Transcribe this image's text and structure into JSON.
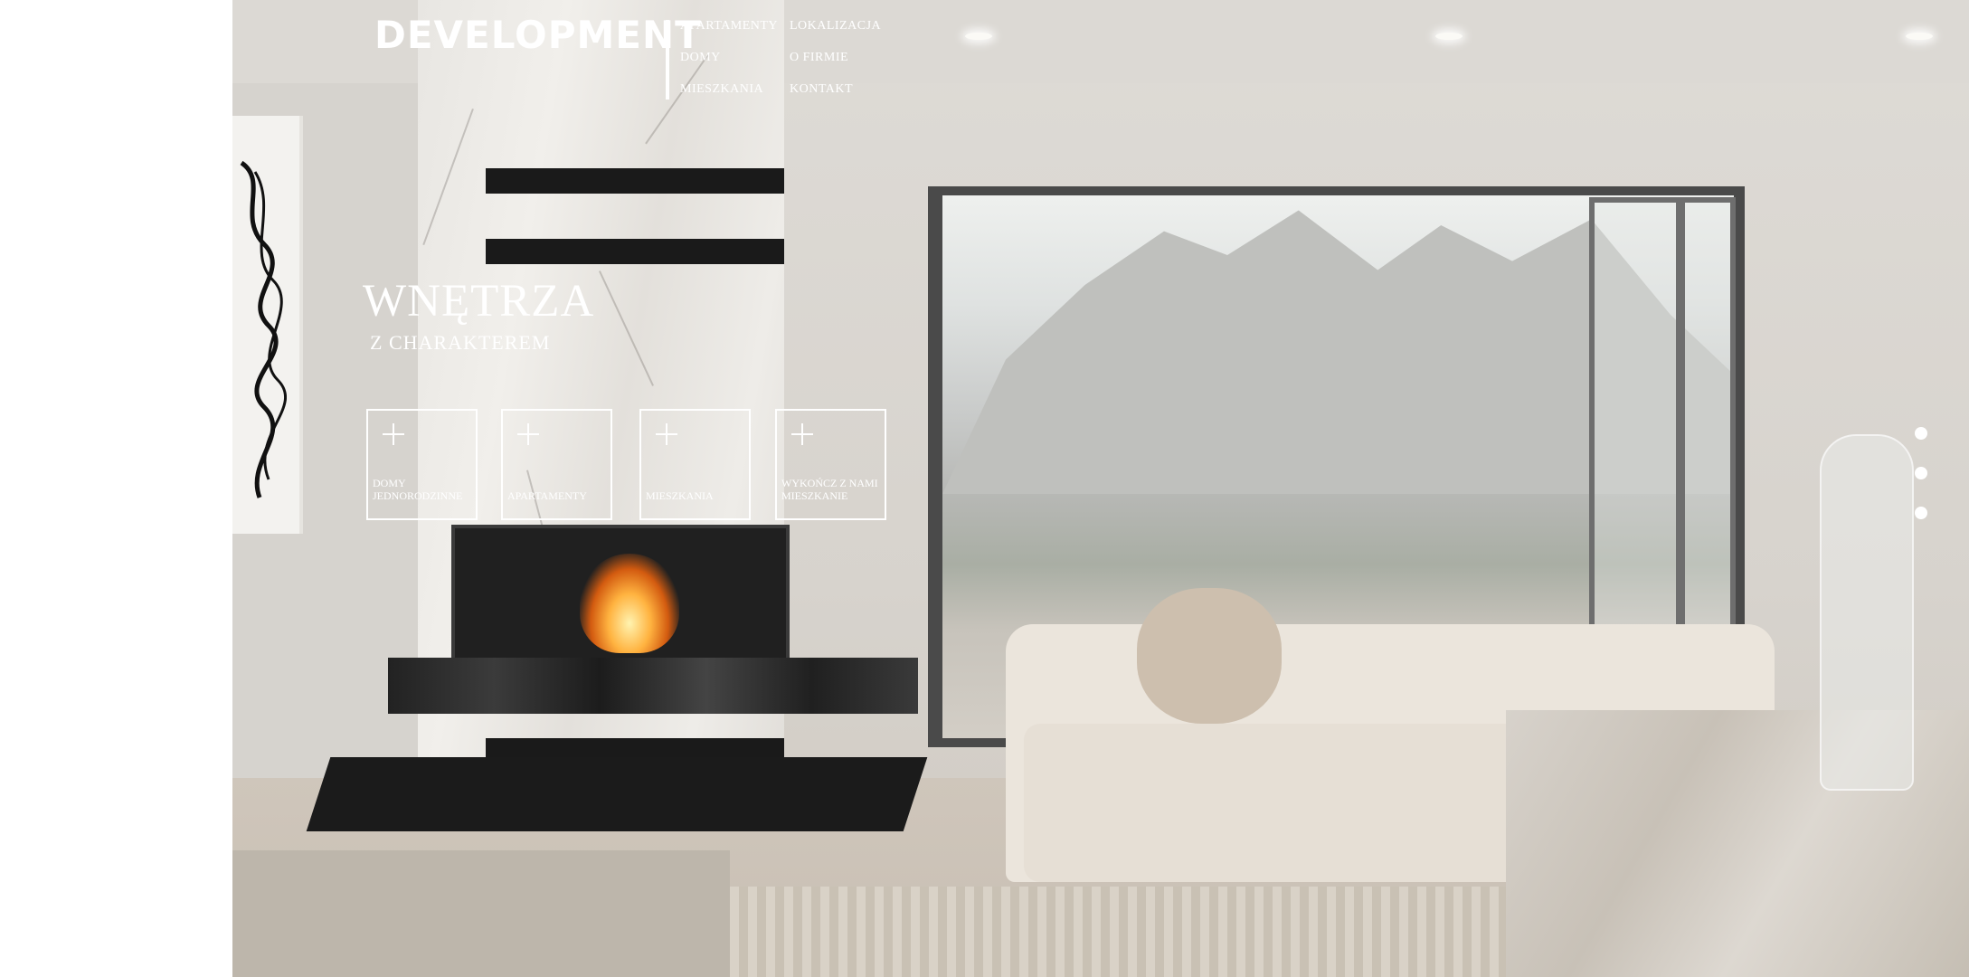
{
  "brand": {
    "logo_text": "DEVELOPMENT"
  },
  "nav": {
    "column_1": [
      "APARTAMENTY",
      "DOMY",
      "MIESZKANIA"
    ],
    "column_2": [
      "LOKALIZACJA",
      "O FIRMIE",
      "KONTAKT"
    ]
  },
  "hero": {
    "title": "WNĘTRZA",
    "subtitle": "Z CHARAKTEREM"
  },
  "tiles": [
    {
      "label": "DOMY\nJEDNORODZINNE",
      "icon": "plus-icon"
    },
    {
      "label": "APARTAMENTY",
      "icon": "plus-icon"
    },
    {
      "label": "MIESZKANIA",
      "icon": "plus-icon"
    },
    {
      "label": "WYKOŃCZ Z NAMI\nMIESZKANIE",
      "icon": "plus-icon"
    }
  ],
  "slider": {
    "dot_count": 3
  },
  "colors": {
    "overlay_text": "#ffffff",
    "page_background": "#ffffff"
  }
}
